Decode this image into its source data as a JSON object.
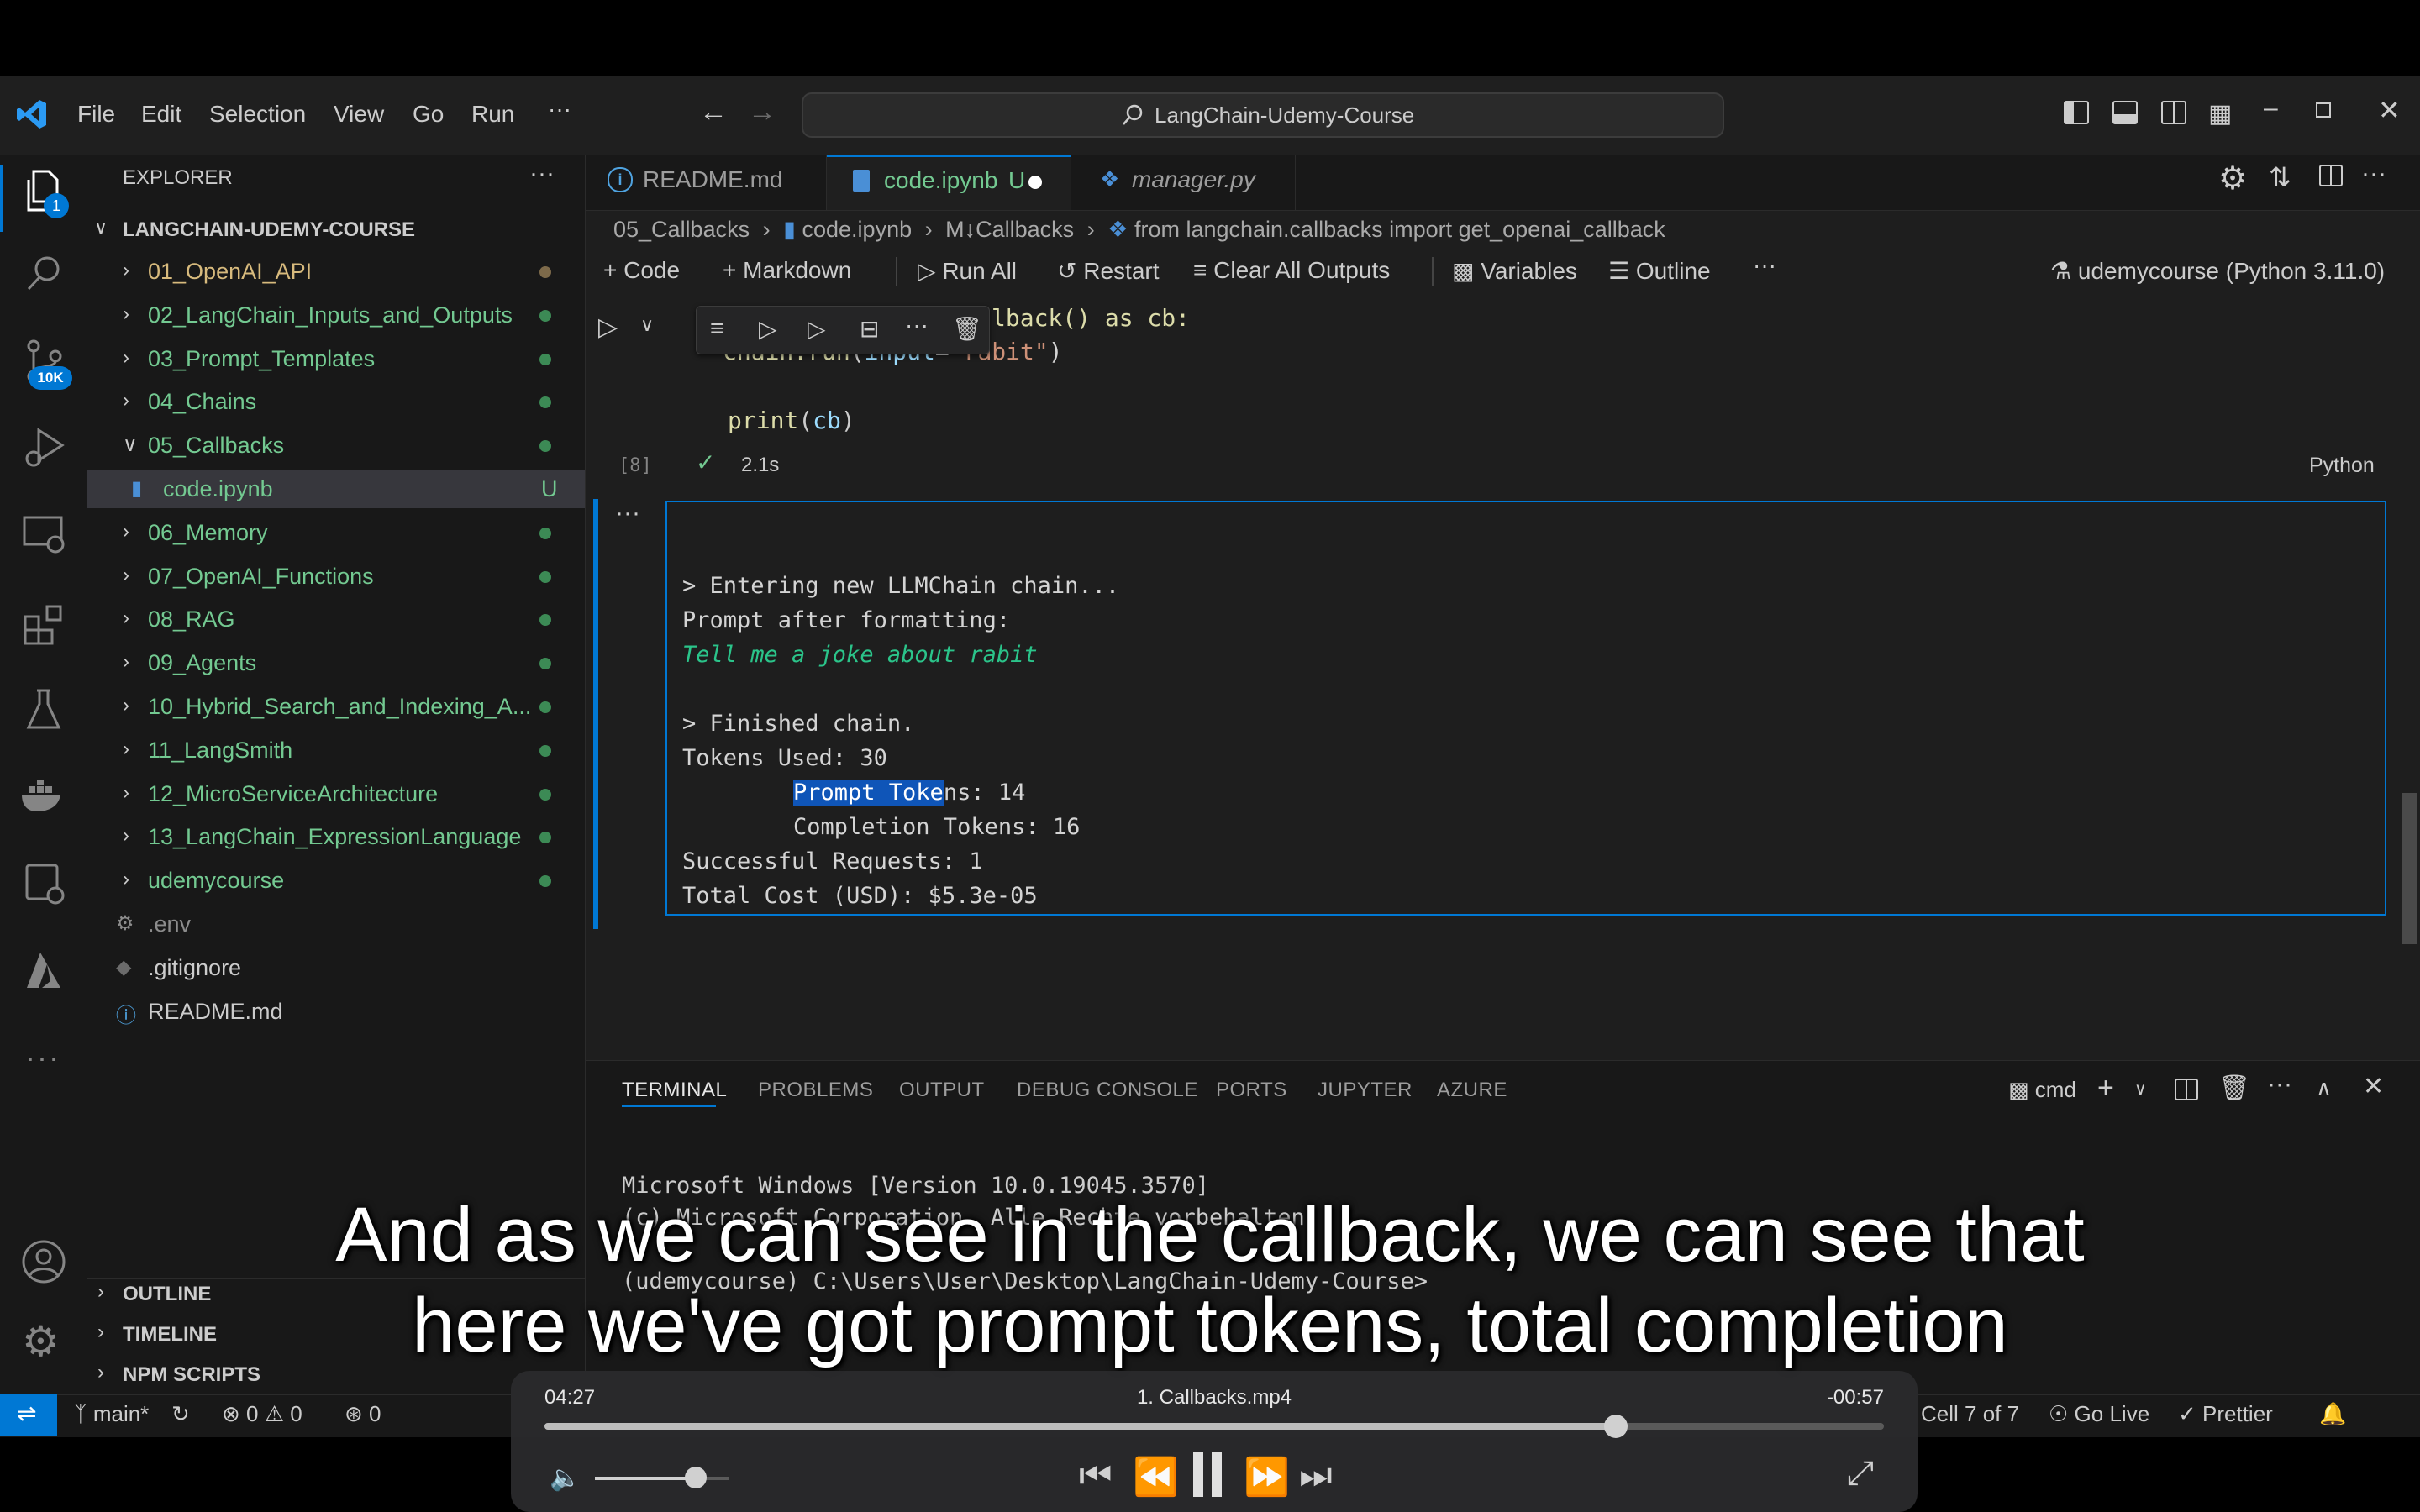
{
  "menu": [
    "File",
    "Edit",
    "Selection",
    "View",
    "Go",
    "Run",
    "···"
  ],
  "search": {
    "text": "LangChain-Udemy-Course"
  },
  "explorer": {
    "title": "EXPLORER",
    "project": "LANGCHAIN-UDEMY-COURSE",
    "items": [
      {
        "label": "01_OpenAI_API",
        "type": "folder",
        "open": false,
        "color": "#d7ba7d",
        "dot": "#7d6a4a"
      },
      {
        "label": "02_LangChain_Inputs_and_Outputs",
        "type": "folder",
        "open": false,
        "color": "#73c991",
        "dot": "#3c8a55"
      },
      {
        "label": "03_Prompt_Templates",
        "type": "folder",
        "open": false,
        "color": "#73c991",
        "dot": "#3c8a55"
      },
      {
        "label": "04_Chains",
        "type": "folder",
        "open": false,
        "color": "#73c991",
        "dot": "#3c8a55"
      },
      {
        "label": "05_Callbacks",
        "type": "folder",
        "open": true,
        "color": "#73c991",
        "dot": "#3c8a55"
      },
      {
        "label": "code.ipynb",
        "type": "file",
        "badge": "U",
        "color": "#73c991"
      },
      {
        "label": "06_Memory",
        "type": "folder",
        "open": false,
        "color": "#73c991",
        "dot": "#3c8a55"
      },
      {
        "label": "07_OpenAI_Functions",
        "type": "folder",
        "open": false,
        "color": "#73c991",
        "dot": "#3c8a55"
      },
      {
        "label": "08_RAG",
        "type": "folder",
        "open": false,
        "color": "#73c991",
        "dot": "#3c8a55"
      },
      {
        "label": "09_Agents",
        "type": "folder",
        "open": false,
        "color": "#73c991",
        "dot": "#3c8a55"
      },
      {
        "label": "10_Hybrid_Search_and_Indexing_A...",
        "type": "folder",
        "open": false,
        "color": "#73c991",
        "dot": "#3c8a55"
      },
      {
        "label": "11_LangSmith",
        "type": "folder",
        "open": false,
        "color": "#73c991",
        "dot": "#3c8a55"
      },
      {
        "label": "12_MicroServiceArchitecture",
        "type": "folder",
        "open": false,
        "color": "#73c991",
        "dot": "#3c8a55"
      },
      {
        "label": "13_LangChain_ExpressionLanguage",
        "type": "folder",
        "open": false,
        "color": "#73c991",
        "dot": "#3c8a55"
      },
      {
        "label": "udemycourse",
        "type": "folder",
        "open": false,
        "color": "#73c991",
        "dot": "#3c8a55"
      },
      {
        "label": ".env",
        "type": "file",
        "color": "#8c8c8c",
        "icon": "gear"
      },
      {
        "label": ".gitignore",
        "type": "file",
        "color": "#cccccc",
        "icon": "diamond"
      },
      {
        "label": "README.md",
        "type": "file",
        "color": "#cccccc",
        "icon": "info"
      }
    ],
    "sections": [
      "OUTLINE",
      "TIMELINE",
      "NPM SCRIPTS"
    ]
  },
  "tabs": [
    {
      "label": "README.md",
      "active": false
    },
    {
      "label": "code.ipynb",
      "badge": "U",
      "active": true
    },
    {
      "label": "manager.py",
      "active": false
    }
  ],
  "breadcrumb": [
    "05_Callbacks",
    "code.ipynb",
    "M↓Callbacks",
    "from langchain.callbacks import get_openai_callback"
  ],
  "toolbar": {
    "code": "Code",
    "markdown": "Markdown",
    "run_all": "Run All",
    "restart": "Restart",
    "clear": "Clear All Outputs",
    "variables": "Variables",
    "outline": "Outline",
    "kernel": "udemycourse (Python 3.11.0)"
  },
  "cell": {
    "line1_visible": "lback() as cb:",
    "line2": "chain.run(input=\"rabit\")",
    "line3": "print(cb)",
    "exec_count": "[8]",
    "duration": "2.1s",
    "language": "Python"
  },
  "output": {
    "l1": "> Entering new LLMChain chain...",
    "l2": "Prompt after formatting:",
    "l3": "Tell me a joke about rabit",
    "l4": "> Finished chain.",
    "l5": "Tokens Used: 30",
    "l6_sel": "Prompt Toke",
    "l6_rest": "ns: 14",
    "l7": "Completion Tokens: 16",
    "l8": "Successful Requests: 1",
    "l9": "Total Cost (USD): $5.3e-05"
  },
  "panel": {
    "tabs": [
      "TERMINAL",
      "PROBLEMS",
      "OUTPUT",
      "DEBUG CONSOLE",
      "PORTS",
      "JUPYTER",
      "AZURE"
    ],
    "shell": "cmd",
    "lines": [
      "Microsoft Windows [Version 10.0.19045.3570]",
      "(c) Microsoft Corporation. Alle Rechte vorbehalten.",
      "(udemycourse) C:\\Users\\User\\Desktop\\LangChain-Udemy-Course>"
    ]
  },
  "status": {
    "branch": "main*",
    "errors": "0",
    "warnings": "0",
    "ports": "0",
    "cell": "Cell 7 of 7",
    "golive": "Go Live",
    "prettier": "Prettier"
  },
  "badges": {
    "explorer": "1",
    "source_control": "10K"
  },
  "subtitle": {
    "line1": "And as we can see in the callback, we can see that",
    "line2": "here we've got prompt tokens, total completion"
  },
  "player": {
    "elapsed": "04:27",
    "title": "1. Callbacks.mp4",
    "remaining": "-00:57",
    "progress": 0.8,
    "volume": 0.75
  },
  "colors": {
    "accent": "#0078d4",
    "git_added": "#73c991",
    "selection": "#264f78"
  }
}
